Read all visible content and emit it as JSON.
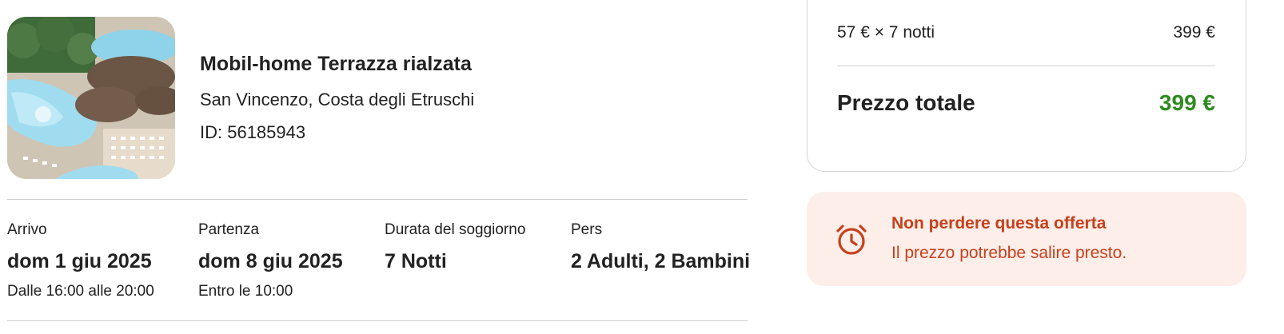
{
  "property": {
    "name": "Mobil-home Terrazza rialzata",
    "location": "San Vincenzo, Costa degli Etruschi",
    "id_label": "ID: 56185943",
    "image_icon": "resort-photo"
  },
  "stay": {
    "arrival": {
      "label": "Arrivo",
      "value": "dom 1 giu 2025",
      "note": "Dalle 16:00 alle 20:00"
    },
    "departure": {
      "label": "Partenza",
      "value": "dom 8 giu 2025",
      "note": "Entro le 10:00"
    },
    "duration": {
      "label": "Durata del soggiorno",
      "value": "7 Notti"
    },
    "guests": {
      "label": "Pers",
      "value": "2 Adulti, 2 Bambini"
    }
  },
  "price": {
    "line_label": "57 € × 7 notti",
    "line_value": "399 €",
    "total_label": "Prezzo totale",
    "total_value": "399 €"
  },
  "urgency": {
    "icon": "alarm-clock-icon",
    "title": "Non perdere questa offerta",
    "text": "Il prezzo potrebbe salire presto."
  },
  "colors": {
    "total_green": "#2e8b1f",
    "urgency_orange": "#c8401c",
    "urgency_bg": "#fdeee9"
  }
}
